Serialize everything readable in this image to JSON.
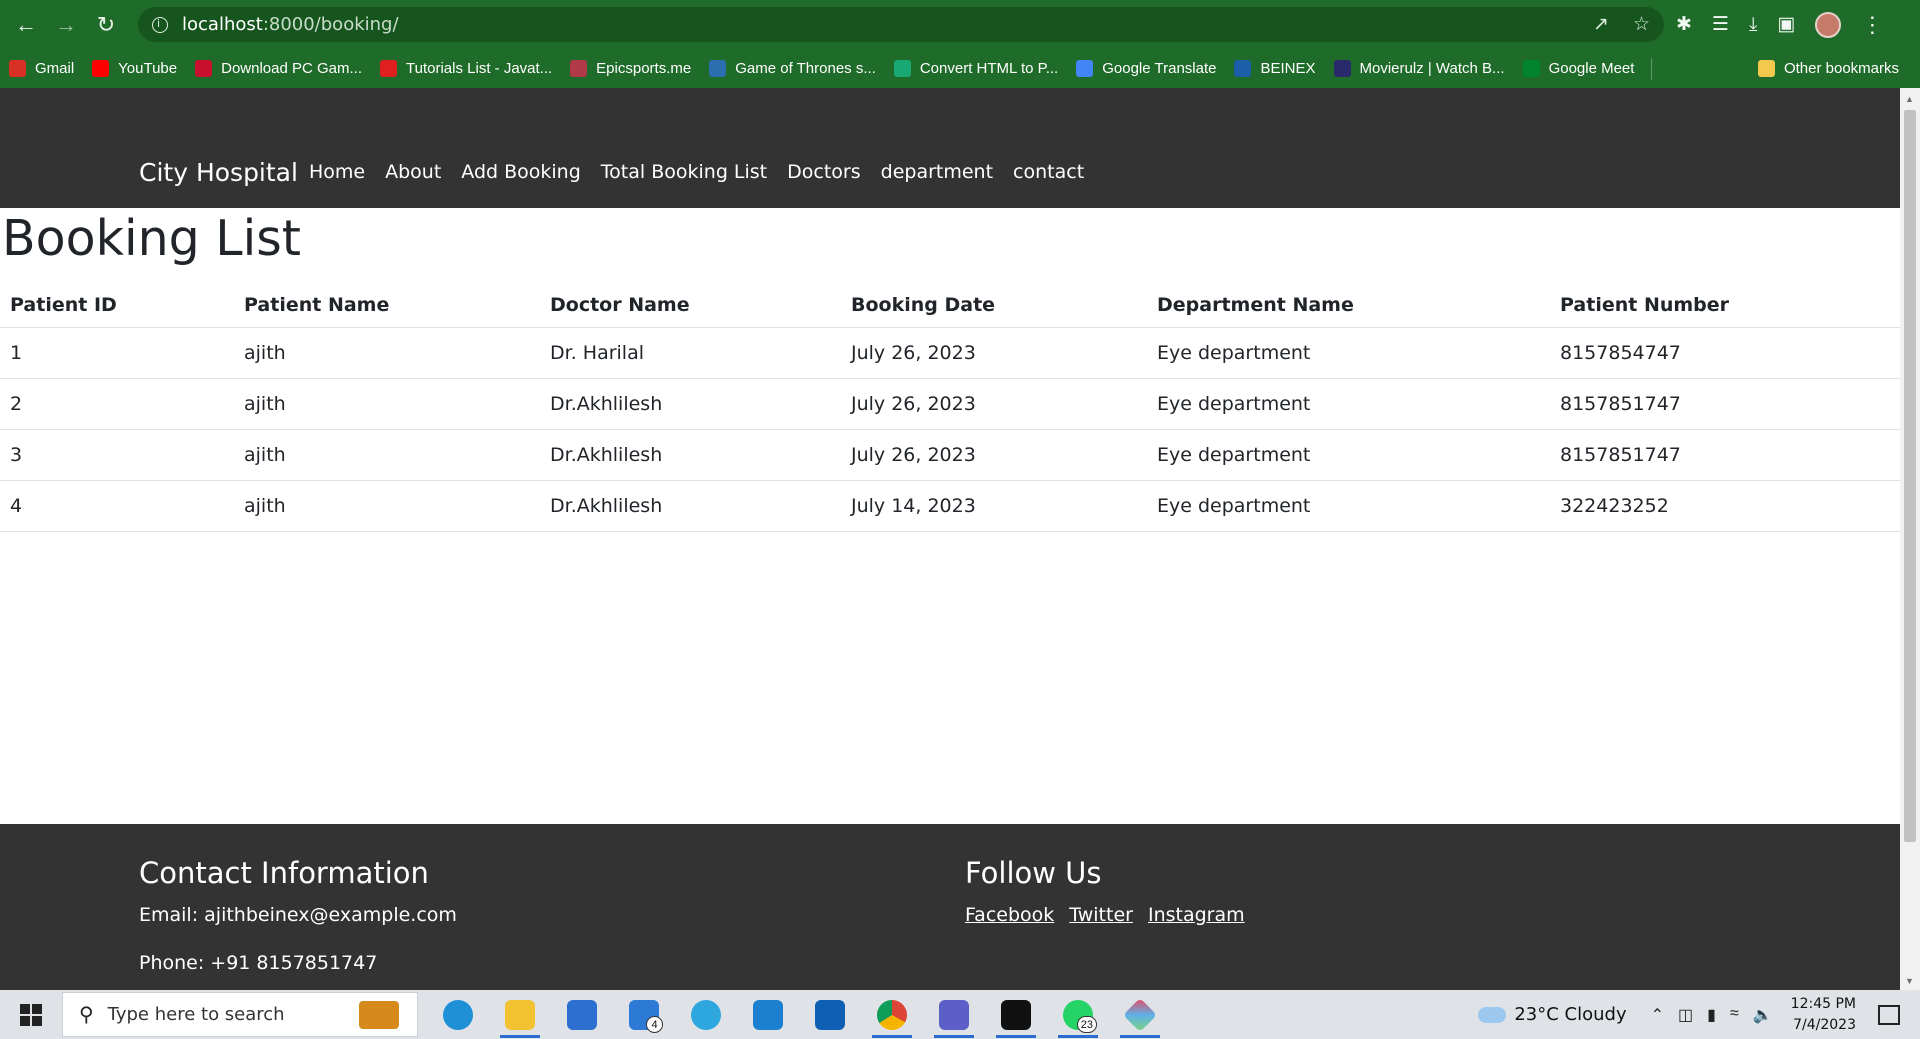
{
  "browser": {
    "url_host": "localhost",
    "url_path": ":8000/booking/",
    "bookmarks": [
      {
        "label": "Gmail",
        "color": "#d93025"
      },
      {
        "label": "YouTube",
        "color": "#ff0000"
      },
      {
        "label": "Download PC Gam...",
        "color": "#c8102e"
      },
      {
        "label": "Tutorials List - Javat...",
        "color": "#e02020"
      },
      {
        "label": "Epicsports.me",
        "color": "#b23a48"
      },
      {
        "label": "Game of Thrones s...",
        "color": "#2c6fb0"
      },
      {
        "label": "Convert HTML to P...",
        "color": "#18a874"
      },
      {
        "label": "Google Translate",
        "color": "#4285f4"
      },
      {
        "label": "BEINEX",
        "color": "#1b5fa8"
      },
      {
        "label": "Movierulz | Watch B...",
        "color": "#2a2a6a"
      },
      {
        "label": "Google Meet",
        "color": "#00832d"
      }
    ],
    "other_bookmarks": "Other bookmarks"
  },
  "site": {
    "brand": "City Hospital",
    "nav": [
      "Home",
      "About",
      "Add Booking",
      "Total Booking List",
      "Doctors",
      "department",
      "contact"
    ]
  },
  "page": {
    "title": "Booking List",
    "columns": [
      "Patient ID",
      "Patient Name",
      "Doctor Name",
      "Booking Date",
      "Department Name",
      "Patient Number"
    ],
    "rows": [
      [
        "1",
        "ajith",
        "Dr. Harilal",
        "July 26, 2023",
        "Eye department",
        "8157854747"
      ],
      [
        "2",
        "ajith",
        "Dr.Akhlilesh",
        "July 26, 2023",
        "Eye department",
        "8157851747"
      ],
      [
        "3",
        "ajith",
        "Dr.Akhlilesh",
        "July 26, 2023",
        "Eye department",
        "8157851747"
      ],
      [
        "4",
        "ajith",
        "Dr.Akhlilesh",
        "July 14, 2023",
        "Eye department",
        "322423252"
      ]
    ]
  },
  "footer": {
    "contact_heading": "Contact Information",
    "email": "Email: ajithbeinex@example.com",
    "phone": "Phone: +91 8157851747",
    "follow_heading": "Follow Us",
    "social": [
      "Facebook",
      "Twitter",
      "Instagram"
    ]
  },
  "taskbar": {
    "search_placeholder": "Type here to search",
    "mail_badge": "4",
    "whatsapp_badge": "23",
    "weather": "23°C  Cloudy",
    "time": "12:45 PM",
    "date": "7/4/2023"
  }
}
